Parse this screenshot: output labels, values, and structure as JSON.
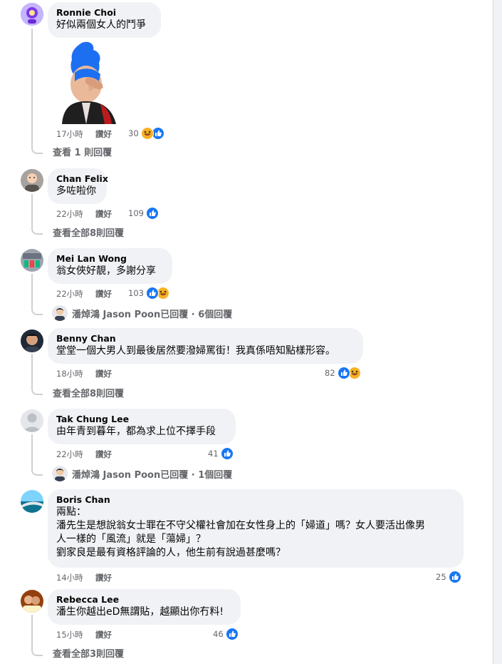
{
  "comments": [
    {
      "author": "Ronnie Choi",
      "lines": [
        "好似兩個女人的鬥爭"
      ],
      "time": "17小時",
      "like": "讚好",
      "count": "30",
      "view": "查看 1 則回覆"
    },
    {
      "author": "Chan Felix",
      "lines": [
        "多咗啦你"
      ],
      "time": "22小時",
      "like": "讚好",
      "count": "109",
      "view": "查看全部8則回覆"
    },
    {
      "author": "Mei Lan Wong",
      "lines": [
        "翁女俠好靚，多謝分享"
      ],
      "time": "22小時",
      "like": "讚好",
      "count": "103",
      "reply": "潘焯鴻 Jason Poon已回覆 · 6個回覆"
    },
    {
      "author": "Benny Chan",
      "lines": [
        "堂堂一個大男人到最後居然要潑婦罵街！我真係唔知點樣形容。"
      ],
      "time": "18小時",
      "like": "讚好",
      "count": "82",
      "view": "查看全部8則回覆"
    },
    {
      "author": "Tak Chung Lee",
      "lines": [
        "由年青到暮年，都為求上位不擇手段"
      ],
      "time": "22小時",
      "like": "讚好",
      "count": "41",
      "reply": "潘焯鴻 Jason Poon已回覆 · 1個回覆"
    },
    {
      "author": "Boris Chan",
      "lines": [
        "兩點：",
        "潘先生是想說翁女士罪在不守父權社會加在女性身上的「婦道」嗎？女人要活出像男",
        "人一樣的「風流」就是「蕩婦」？",
        "劉家良是最有資格評論的人，他生前有說過甚麼嗎？"
      ],
      "time": "14小時",
      "like": "讚好",
      "count": "25"
    },
    {
      "author": "Rebecca Lee",
      "lines": [
        "潘生你越出eD無謂貼，越顯出你冇料!"
      ],
      "time": "15小時",
      "like": "讚好",
      "count": "46",
      "view": "查看全部3則回覆"
    }
  ],
  "colors": {
    "like_blue": "#1877f2",
    "haha_yellow": "#f7b125",
    "meta_gray": "#65676b",
    "bubble": "#f0f2f5"
  },
  "icons": {
    "like": "like-reaction-icon",
    "haha": "haha-reaction-icon"
  }
}
